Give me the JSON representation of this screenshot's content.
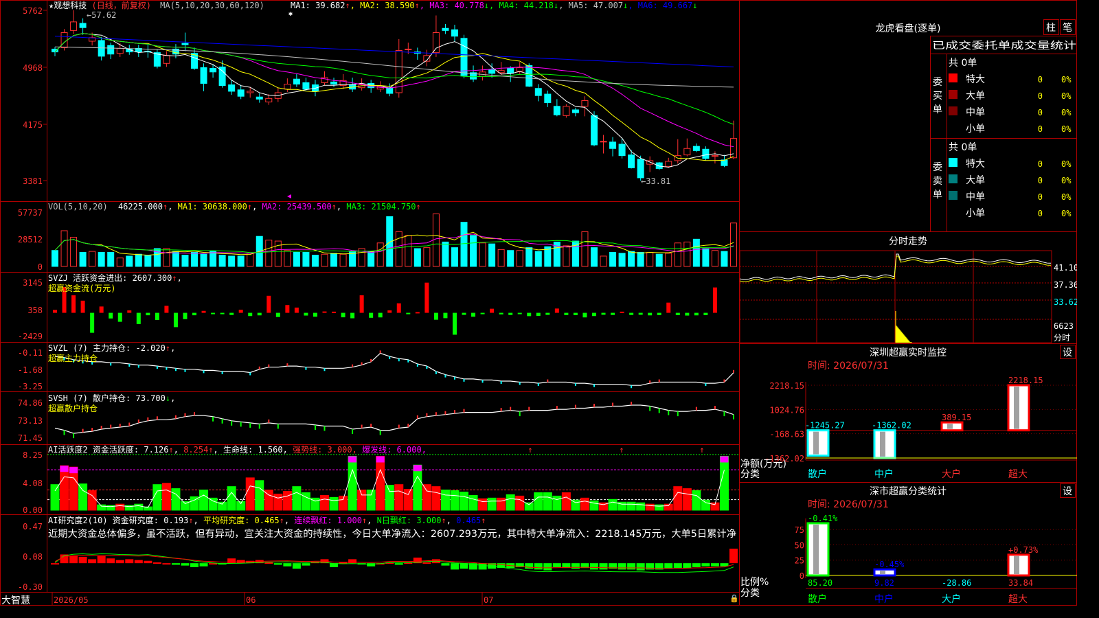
{
  "app": {
    "brand": "大智慧",
    "stock_title": "★观想科技",
    "period": "(日线，前复权)",
    "dates": [
      "2026/05",
      "06",
      "07"
    ]
  },
  "price_panel": {
    "ma_label": "MA(5,10,20,30,60,120)",
    "ma_values": [
      {
        "label": "MA1: 39.682",
        "arrow": "↑",
        "color": "#ffffff"
      },
      {
        "label": "MA2: 38.590",
        "arrow": "↑",
        "color": "#ffff00"
      },
      {
        "label": "MA3: 40.778",
        "arrow": "↓",
        "color": "#ff00ff"
      },
      {
        "label": "MA4: 44.218",
        "arrow": "↓",
        "color": "#00ff00"
      },
      {
        "label": "MA5: 47.007",
        "arrow": "↓",
        "color": "#c0c0c0"
      },
      {
        "label": "MA6: 49.667",
        "arrow": "↓",
        "color": "#0000ff"
      }
    ],
    "y_ticks": [
      "5762",
      "4968",
      "4175",
      "3381"
    ],
    "high_label": "57.62",
    "low_label": "←33.81"
  },
  "volume_panel": {
    "label": "VOL(5,10,20)",
    "value": "46225.000",
    "ma_values": [
      {
        "label": "MA1: 30638.000",
        "color": "#ffff00"
      },
      {
        "label": "MA2: 25439.500",
        "color": "#ff00ff"
      },
      {
        "label": "MA3: 21504.750",
        "color": "#00ff00"
      }
    ],
    "y_ticks": [
      "57737",
      "28512",
      "0"
    ]
  },
  "svzj_panel": {
    "label": "SVZJ  活跃资金进出: 2607.300",
    "sub": "超赢资金流(万元)",
    "y_ticks": [
      "3145",
      "358",
      "-2429"
    ]
  },
  "svzl_panel": {
    "label": "SVZL (7) 主力持仓: -2.020",
    "sub": "超赢主力持仓",
    "y_ticks": [
      "-0.11",
      "-1.68",
      "-3.25"
    ]
  },
  "svsh_panel": {
    "label": "SVSH (7) 散户持仓: 73.700",
    "sub": "超赢散户持仓",
    "y_ticks": [
      "74.86",
      "73.13",
      "71.45"
    ]
  },
  "ai_active_panel": {
    "label": "AI活跃度2 资金活跃度: 7.126",
    "v2": "8.254",
    "lifeline": "生命线: 1.560",
    "strong": "强势线: 3.000",
    "burst": "爆发线: 6.000",
    "y_ticks": [
      "8.25",
      "4.08",
      "0.00"
    ]
  },
  "ai_research_panel": {
    "label": "AI研究度2(10) 资金研究度: 0.193",
    "avg": "平均研究度: 0.465",
    "streak": "连续飘红: 1.000",
    "nday": "N日飘红: 3.000",
    "last": "0.465",
    "comment": "近期大资金总体偏多，虽不活跃，但有异动，宜关注大资金的持续性，今日大单净流入：2607.293万元，其中特大单净流入：2218.145万元，大单5日累计净",
    "y_ticks": [
      "0.47",
      "0.08",
      "-0.30"
    ]
  },
  "right_panel": {
    "dragon_title": "龙虎看盘(逐单)",
    "btn_bar": "柱",
    "btn_pen": "笔",
    "order_stats_title": "已成交委托单成交量统计",
    "buy_side_label": "委买单",
    "sell_side_label": "委卖单",
    "buy_total": "共 0单",
    "sell_total": "共 0单",
    "buy_rows": [
      {
        "name": "特大",
        "count": "0",
        "pct": "0%",
        "color": "#ff0000"
      },
      {
        "name": "大单",
        "count": "0",
        "pct": "0%",
        "color": "#a00000"
      },
      {
        "name": "中单",
        "count": "0",
        "pct": "0%",
        "color": "#800000"
      },
      {
        "name": "小单",
        "count": "0",
        "pct": "0%",
        "color": "#000000"
      }
    ],
    "sell_rows": [
      {
        "name": "特大",
        "count": "0",
        "pct": "0%",
        "color": "#00ffff"
      },
      {
        "name": "大单",
        "count": "0",
        "pct": "0%",
        "color": "#008080"
      },
      {
        "name": "中单",
        "count": "0",
        "pct": "0%",
        "color": "#007070"
      },
      {
        "name": "小单",
        "count": "0",
        "pct": "0%",
        "color": "#000000"
      }
    ],
    "intraday_title": "分时走势",
    "intraday_ticks": [
      "41.10",
      "37.36",
      "33.62",
      "6623",
      "分时"
    ],
    "sz_monitor_title": "深圳超赢实时监控",
    "sz_monitor_btn": "设",
    "sz_time": "时间: 2026/07/31",
    "sz_y_ticks": [
      "2218.15",
      "1024.76",
      "-168.63",
      "-1362.02"
    ],
    "sz_y_label": "净额(万元)",
    "sz_x_label": "分类",
    "sz_bars": [
      {
        "name": "散户",
        "value": -1245.27,
        "label": "-1245.27"
      },
      {
        "name": "中户",
        "value": -1362.02,
        "label": "-1362.02"
      },
      {
        "name": "大户",
        "value": 389.15,
        "label": "389.15"
      },
      {
        "name": "超大",
        "value": 2218.15,
        "label": "2218.15"
      }
    ],
    "sz_class_title": "深市超赢分类统计",
    "sz_class_btn": "设",
    "sz_class_time": "时间: 2026/07/31",
    "sz_class_y_ticks": [
      "75",
      "50",
      "25",
      "0"
    ],
    "sz_class_y_label": "比例%",
    "sz_class_x_label": "分类",
    "sz_class_bars": [
      {
        "name": "散户",
        "value": 85.2,
        "top": "-0.41%",
        "bottom": "85.20"
      },
      {
        "name": "中户",
        "value": 9.82,
        "top": "-0.45%",
        "bottom": "9.82"
      },
      {
        "name": "大户",
        "value": -28.86,
        "top": "",
        "bottom": "-28.86"
      },
      {
        "name": "超大",
        "value": 33.84,
        "top": "+0.73%",
        "bottom": "33.84"
      }
    ]
  },
  "chart_data": {
    "type": "candlestick",
    "title": "★观想科技(日线，前复权)",
    "ylim": [
      33.81,
      57.62
    ],
    "high_marker": 57.62,
    "low_marker": 33.81,
    "candles": [
      [
        52.2,
        51.8,
        52.5,
        51.2
      ],
      [
        52.4,
        54.5,
        55.0,
        52.0
      ],
      [
        54.8,
        56.0,
        57.62,
        54.3
      ],
      [
        55.8,
        55.2,
        56.5,
        54.2
      ],
      [
        53.3,
        53.8,
        54.5,
        52.7
      ],
      [
        53.4,
        51.2,
        53.9,
        50.6
      ],
      [
        52.7,
        51.5,
        53.1,
        50.8
      ],
      [
        51.6,
        52.3,
        53.1,
        51.1
      ],
      [
        52.2,
        51.8,
        52.8,
        51.4
      ],
      [
        52.3,
        51.8,
        52.8,
        51.1
      ],
      [
        51.9,
        51.8,
        52.8,
        51.0
      ],
      [
        51.7,
        49.8,
        52.2,
        49.5
      ],
      [
        50.2,
        51.3,
        51.9,
        49.7
      ],
      [
        52.2,
        51.5,
        52.9,
        50.9
      ],
      [
        53.0,
        52.8,
        54.5,
        51.9
      ],
      [
        51.6,
        49.5,
        52.4,
        49.3
      ],
      [
        49.6,
        47.4,
        50.2,
        46.3
      ],
      [
        49.5,
        49.0,
        50.1,
        48.2
      ],
      [
        49.7,
        47.1,
        50.6,
        46.8
      ],
      [
        47.2,
        46.3,
        47.9,
        45.8
      ],
      [
        46.5,
        45.6,
        47.2,
        45.2
      ],
      [
        46.1,
        46.3,
        46.9,
        45.4
      ],
      [
        45.5,
        45.2,
        46.0,
        44.7
      ],
      [
        44.8,
        45.3,
        45.9,
        44.4
      ],
      [
        45.3,
        46.1,
        46.8,
        44.8
      ],
      [
        46.6,
        47.3,
        48.1,
        46.2
      ],
      [
        48.0,
        47.3,
        48.7,
        46.9
      ],
      [
        47.5,
        46.6,
        48.2,
        46.4
      ],
      [
        47.2,
        46.3,
        47.9,
        45.6
      ],
      [
        47.5,
        48.2,
        49.1,
        47.1
      ],
      [
        47.6,
        47.3,
        48.2,
        46.9
      ],
      [
        47.1,
        47.8,
        48.7,
        46.6
      ],
      [
        47.2,
        46.6,
        48.2,
        46.2
      ],
      [
        46.8,
        47.2,
        48.1,
        46.4
      ],
      [
        47.4,
        46.8,
        47.9,
        46.1
      ],
      [
        46.6,
        47.0,
        47.7,
        46.2
      ],
      [
        46.8,
        46.0,
        47.4,
        45.6
      ],
      [
        46.1,
        52.0,
        53.6,
        45.4
      ],
      [
        52.1,
        52.2,
        53.1,
        51.5
      ],
      [
        51.8,
        51.6,
        52.4,
        50.7
      ],
      [
        50.5,
        51.3,
        52.1,
        49.8
      ],
      [
        51.7,
        54.5,
        56.9,
        51.1
      ],
      [
        55.1,
        54.8,
        55.7,
        54.3
      ],
      [
        54.9,
        54.0,
        55.6,
        53.2
      ],
      [
        53.7,
        48.5,
        54.2,
        48.1
      ],
      [
        48.9,
        48.0,
        49.9,
        47.6
      ],
      [
        48.4,
        49.0,
        49.9,
        47.8
      ],
      [
        49.3,
        48.8,
        50.2,
        48.2
      ],
      [
        48.9,
        49.2,
        50.4,
        48.6
      ],
      [
        49.5,
        48.8,
        49.8,
        47.6
      ],
      [
        49.1,
        49.6,
        50.4,
        48.7
      ],
      [
        49.9,
        47.0,
        50.2,
        46.9
      ],
      [
        46.7,
        45.7,
        47.3,
        44.9
      ],
      [
        45.9,
        44.7,
        46.4,
        44.1
      ],
      [
        44.2,
        43.0,
        45.2,
        42.8
      ],
      [
        42.9,
        44.2,
        44.5,
        42.6
      ],
      [
        43.7,
        43.3,
        44.0,
        42.8
      ],
      [
        44.2,
        45.0,
        45.6,
        42.8
      ],
      [
        42.9,
        38.8,
        43.5,
        38.6
      ],
      [
        39.3,
        39.3,
        40.2,
        37.6
      ],
      [
        39.2,
        38.3,
        39.9,
        37.2
      ],
      [
        38.9,
        37.3,
        39.8,
        36.9
      ],
      [
        37.4,
        35.6,
        38.1,
        35.5
      ],
      [
        36.8,
        34.2,
        37.3,
        33.81
      ],
      [
        36.1,
        36.6,
        37.2,
        35.0
      ],
      [
        36.3,
        35.5,
        36.4,
        35.3
      ],
      [
        35.8,
        36.5,
        37.0,
        35.6
      ],
      [
        36.6,
        37.3,
        39.6,
        36.2
      ],
      [
        37.4,
        38.3,
        39.7,
        37.2
      ],
      [
        38.6,
        38.0,
        39.0,
        37.8
      ],
      [
        38.2,
        36.9,
        38.6,
        36.6
      ],
      [
        37.2,
        37.3,
        37.9,
        36.2
      ],
      [
        36.7,
        35.9,
        37.4,
        35.7
      ],
      [
        37.0,
        39.7,
        42.2,
        36.8
      ]
    ],
    "volume": [
      17000,
      38000,
      31000,
      15000,
      16000,
      15000,
      15000,
      9000,
      11000,
      13000,
      12000,
      19000,
      19000,
      16000,
      12000,
      15000,
      13000,
      16000,
      12000,
      11000,
      11000,
      14000,
      32000,
      28000,
      27000,
      17000,
      15000,
      15000,
      12000,
      13000,
      14000,
      13000,
      16000,
      19000,
      16000,
      25000,
      53000,
      37000,
      33000,
      19000,
      20000,
      56000,
      26000,
      20000,
      47000,
      33000,
      25000,
      24000,
      18000,
      17000,
      17000,
      20000,
      16000,
      21000,
      26000,
      22000,
      27000,
      37000,
      20000,
      11000,
      15000,
      14000,
      16000,
      15000,
      15000,
      13000,
      14000,
      25000,
      26000,
      29000,
      19000,
      17000,
      16000,
      46225
    ],
    "fund_flow": [
      300,
      2650,
      1800,
      1250,
      -2050,
      650,
      -580,
      -920,
      250,
      -1150,
      -250,
      -730,
      720,
      -1470,
      -650,
      -250,
      200,
      -60,
      -40,
      -220,
      320,
      -330,
      -260,
      1750,
      -430,
      800,
      540,
      -280,
      -400,
      140,
      120,
      -460,
      -560,
      1800,
      -510,
      -470,
      250,
      980,
      -80,
      80,
      3100,
      -710,
      -550,
      -2250,
      -210,
      -400,
      -120,
      420,
      -160,
      -220,
      -130,
      -340,
      -310,
      -210,
      440,
      -230,
      -240,
      -470,
      -330,
      -200,
      -220,
      120,
      -220,
      -200,
      -260,
      -230,
      1050,
      -240,
      -280,
      -260,
      -240,
      2607
    ],
    "ai_active": [
      3.8,
      6.6,
      6.4,
      3.9,
      2.9,
      0.8,
      0.7,
      0.9,
      0.7,
      0.9,
      0.5,
      3.8,
      4.0,
      3.2,
      1.3,
      2.0,
      3.0,
      1.8,
      1.2,
      3.5,
      1.3,
      4.8,
      4.4,
      3.0,
      2.4,
      2.8,
      3.5,
      2.6,
      1.8,
      2.2,
      1.9,
      2.1,
      8.0,
      3.0,
      3.0,
      8.0,
      3.7,
      3.8,
      3.1,
      6.7,
      3.8,
      3.5,
      3.0,
      2.9,
      2.7,
      2.2,
      1.7,
      1.8,
      1.8,
      2.3,
      2.1,
      1.1,
      2.6,
      2.6,
      2.1,
      2.6,
      1.5,
      1.8,
      1.4,
      1.1,
      1.6,
      1.2,
      1.2,
      1.1,
      0.9,
      0.8,
      0.9,
      3.5,
      3.2,
      2.9,
      1.5,
      1.1,
      8.0
    ],
    "svzl": [
      -0.5,
      -0.6,
      -0.8,
      -0.9,
      -1.0,
      -1.0,
      -1.1,
      -1.1,
      -1.2,
      -1.3,
      -1.3,
      -1.4,
      -1.5,
      -1.6,
      -1.7,
      -1.7,
      -1.8,
      -1.8,
      -1.9,
      -1.9,
      -1.9,
      -2.0,
      -1.7,
      -1.5,
      -1.5,
      -1.4,
      -1.4,
      -1.5,
      -1.5,
      -1.6,
      -1.6,
      -1.6,
      -1.5,
      -1.3,
      -1.0,
      -0.2,
      -0.5,
      -0.7,
      -0.8,
      -1.2,
      -1.4,
      -1.9,
      -2.2,
      -2.4,
      -2.6,
      -2.6,
      -2.7,
      -2.7,
      -2.8,
      -2.8,
      -2.9,
      -2.9,
      -3.0,
      -2.9,
      -2.9,
      -2.9,
      -3.0,
      -3.0,
      -3.1,
      -3.1,
      -3.1,
      -3.1,
      -3.2,
      -3.2,
      -3.0,
      -2.9,
      -2.9,
      -2.9,
      -2.9,
      -2.9,
      -3.0,
      -3.0,
      -2.9,
      -2.02
    ],
    "svsh": [
      72.4,
      72.2,
      71.9,
      72.0,
      72.1,
      72.3,
      72.4,
      72.5,
      72.6,
      72.9,
      73.1,
      73.2,
      73.2,
      73.3,
      73.5,
      73.6,
      73.6,
      73.5,
      73.3,
      73.1,
      73.0,
      72.9,
      72.8,
      72.9,
      72.8,
      72.8,
      72.8,
      72.8,
      72.7,
      72.6,
      72.6,
      72.6,
      72.3,
      72.4,
      72.5,
      72.2,
      72.2,
      72.4,
      72.5,
      73.3,
      73.5,
      73.6,
      73.7,
      73.8,
      73.9,
      73.9,
      73.9,
      73.9,
      74.0,
      74.1,
      74.0,
      74.1,
      74.1,
      74.1,
      74.2,
      74.2,
      74.3,
      74.3,
      74.4,
      74.4,
      74.5,
      74.5,
      74.6,
      74.6,
      74.5,
      74.3,
      74.1,
      74.0,
      74.0,
      74.1,
      74.1,
      74.2,
      74.0,
      73.7
    ],
    "research": [
      0.01,
      0.12,
      0.1,
      0.09,
      0.06,
      0.1,
      0.07,
      0.05,
      0.06,
      0.05,
      0.04,
      0.02,
      0.01,
      -0.01,
      -0.02,
      -0.04,
      -0.03,
      0.01,
      0.0,
      0.07,
      0.05,
      0.04,
      0.05,
      0.02,
      -0.01,
      -0.03,
      -0.06,
      -0.02,
      0.03,
      0.06,
      -0.04,
      0.02,
      0.06,
      0.0,
      -0.03,
      0.01,
      0.02,
      -0.01,
      0.02,
      0.08,
      0.02,
      0.06,
      -0.02,
      -0.07,
      -0.06,
      -0.07,
      -0.07,
      -0.06,
      -0.05,
      -0.05,
      -0.04,
      -0.06,
      -0.07,
      -0.08,
      -0.04,
      -0.05,
      -0.06,
      -0.05,
      -0.07,
      -0.07,
      -0.06,
      -0.07,
      -0.07,
      -0.08,
      -0.07,
      -0.07,
      -0.06,
      -0.05,
      -0.05,
      -0.04,
      -0.03,
      -0.03,
      -0.03,
      0.193
    ]
  }
}
